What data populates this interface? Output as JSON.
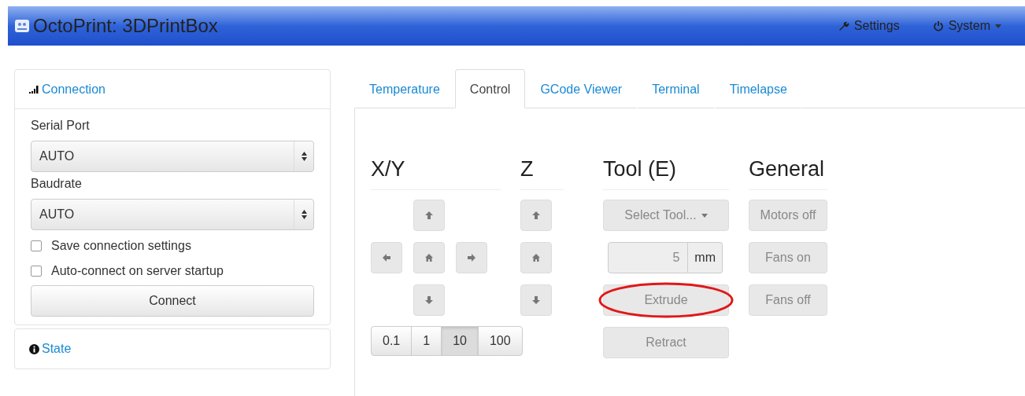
{
  "navbar": {
    "brand": "OctoPrint: 3DPrintBox",
    "items": [
      {
        "label": "Settings",
        "kind": "settings"
      },
      {
        "label": "System",
        "kind": "power",
        "dropdown": true
      }
    ]
  },
  "sidebar": {
    "connection": {
      "title": "Connection",
      "serial_port": {
        "label": "Serial Port",
        "value": "AUTO"
      },
      "baudrate": {
        "label": "Baudrate",
        "value": "AUTO"
      },
      "options": [
        {
          "label": "Save connection settings",
          "checked": false
        },
        {
          "label": "Auto-connect on server startup",
          "checked": false
        }
      ],
      "button": "Connect"
    },
    "state": {
      "title": "State"
    }
  },
  "tabs": [
    {
      "label": "Temperature",
      "selected": false
    },
    {
      "label": "Control",
      "selected": true
    },
    {
      "label": "GCode Viewer",
      "selected": false
    },
    {
      "label": "Terminal",
      "selected": false
    },
    {
      "label": "Timelapse",
      "selected": false
    }
  ],
  "control": {
    "xy": {
      "title": "X/Y",
      "disabled": true
    },
    "z": {
      "title": "Z",
      "disabled": true
    },
    "distances": [
      {
        "label": "0.1",
        "selected": false
      },
      {
        "label": "1",
        "selected": false
      },
      {
        "label": "10",
        "selected": true
      },
      {
        "label": "100",
        "selected": false
      }
    ],
    "tool": {
      "title": "Tool (E)",
      "select": "Select Tool...",
      "amount": "5",
      "unit": "mm",
      "buttons": [
        {
          "label": "Extrude",
          "disabled": true,
          "circled": true
        },
        {
          "label": "Retract",
          "disabled": true,
          "circled": false
        }
      ]
    },
    "general": {
      "title": "General",
      "buttons": [
        {
          "label": "Motors off",
          "disabled": true
        },
        {
          "label": "Fans on",
          "disabled": true
        },
        {
          "label": "Fans off",
          "disabled": true
        }
      ]
    }
  }
}
